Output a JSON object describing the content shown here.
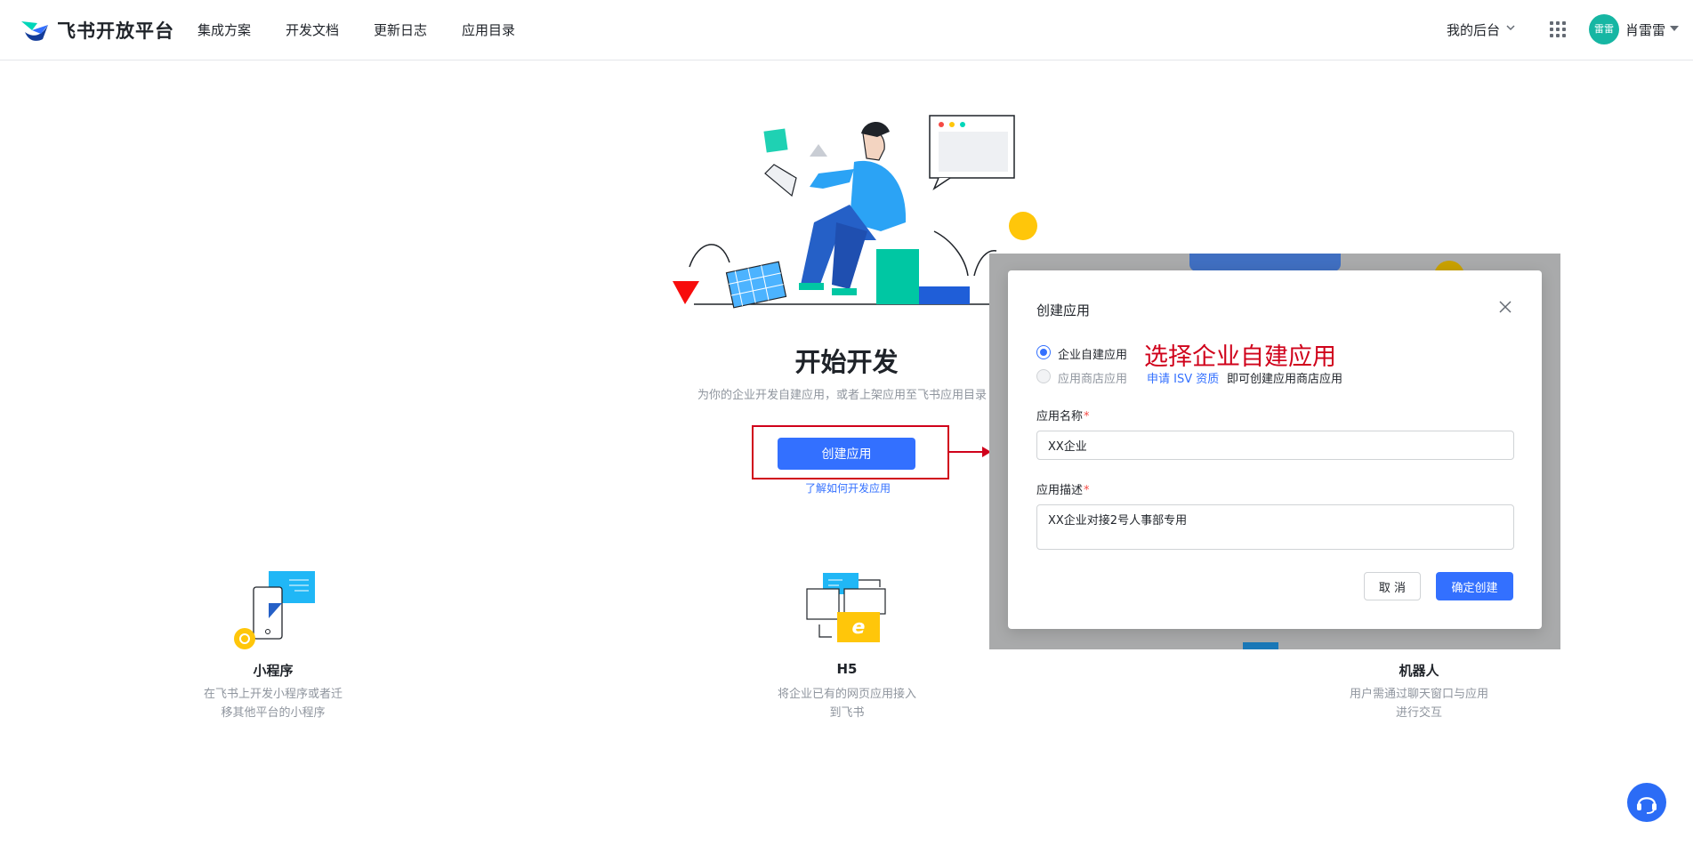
{
  "header": {
    "brand": "飞书开放平台",
    "nav": [
      "集成方案",
      "开发文档",
      "更新日志",
      "应用目录"
    ],
    "my_backend": "我的后台",
    "avatar_text": "雷雷",
    "user_name": "肖雷雷"
  },
  "hero": {
    "title": "开始开发",
    "subtitle": "为你的企业开发自建应用，或者上架应用至飞书应用目录",
    "create_button": "创建应用",
    "learn_link": "了解如何开发应用"
  },
  "features": [
    {
      "title": "小程序",
      "desc_line1": "在飞书上开发小程序或者迁",
      "desc_line2": "移其他平台的小程序"
    },
    {
      "title": "H5",
      "desc_line1": "将企业已有的网页应用接入",
      "desc_line2": "到飞书"
    },
    {
      "title": "机器人",
      "desc_line1": "用户需通过聊天窗口与应用",
      "desc_line2": "进行交互"
    }
  ],
  "modal": {
    "title": "创建应用",
    "option_custom": "企业自建应用",
    "option_store": "应用商店应用",
    "annotation": "选择企业自建应用",
    "isv_link": "申请 ISV 资质",
    "isv_rest": "即可创建应用商店应用",
    "name_label": "应用名称",
    "name_value": "XX企业",
    "desc_label": "应用描述",
    "desc_value": "XX企业对接2号人事部专用",
    "required_mark": "*",
    "cancel": "取 消",
    "confirm": "确定创建",
    "selected_option": "企业自建应用"
  },
  "colors": {
    "primary": "#3370ff",
    "annotation_red": "#d0021b",
    "overlay": "#a9aaab",
    "avatar": "#16b6a3"
  },
  "icons": [
    "feishu-logo-icon",
    "chevron-down-icon",
    "app-grid-icon",
    "close-icon",
    "headset-icon",
    "mini-program-icon",
    "h5-icon"
  ]
}
